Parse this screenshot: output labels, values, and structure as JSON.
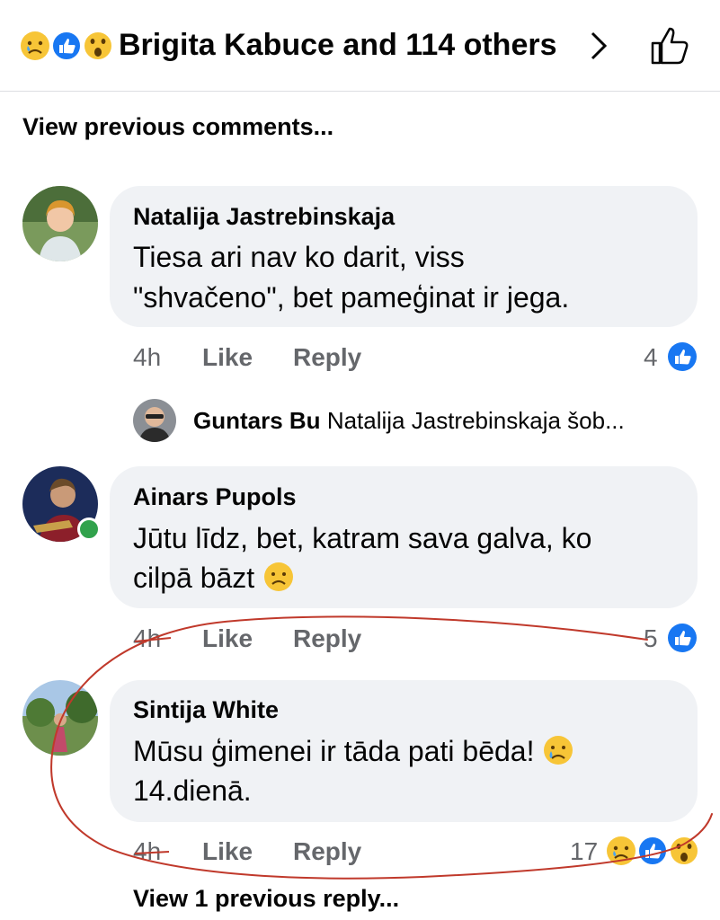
{
  "header": {
    "reactions": [
      "sad-reaction-icon",
      "like-reaction-icon",
      "wow-reaction-icon"
    ],
    "title": "Brigita Kabuce and 114 others"
  },
  "view_previous_comments": "View previous comments...",
  "comments": [
    {
      "author": "Natalija Jastrebinskaja",
      "lines": [
        "Tiesa ari nav ko darit, viss",
        "\"shvačeno\", bet pameģinat ir jega."
      ],
      "time": "4h",
      "like": "Like",
      "reply": "Reply",
      "reaction_count": "4"
    },
    {
      "author": "Ainars Pupols",
      "lines": [
        "Jūtu līdz, bet, katram sava galva, ko",
        "cilpā bāzt"
      ],
      "time": "4h",
      "like": "Like",
      "reply": "Reply",
      "reaction_count": "5"
    },
    {
      "author": "Sintija White",
      "lines": [
        "Mūsu ģimenei ir tāda pati bēda!",
        "14.dienā."
      ],
      "time": "4h",
      "like": "Like",
      "reply": "Reply",
      "reaction_count": "17"
    }
  ],
  "reply_preview": {
    "author": "Guntars Bu",
    "text": "Natalija Jastrebinskaja šob..."
  },
  "view_previous_reply": "View 1 previous reply...",
  "colors": {
    "like_blue": "#1877f2",
    "bubble_bg": "#f0f2f5",
    "meta_gray": "#65676b",
    "annotation_red": "#c0392b"
  }
}
